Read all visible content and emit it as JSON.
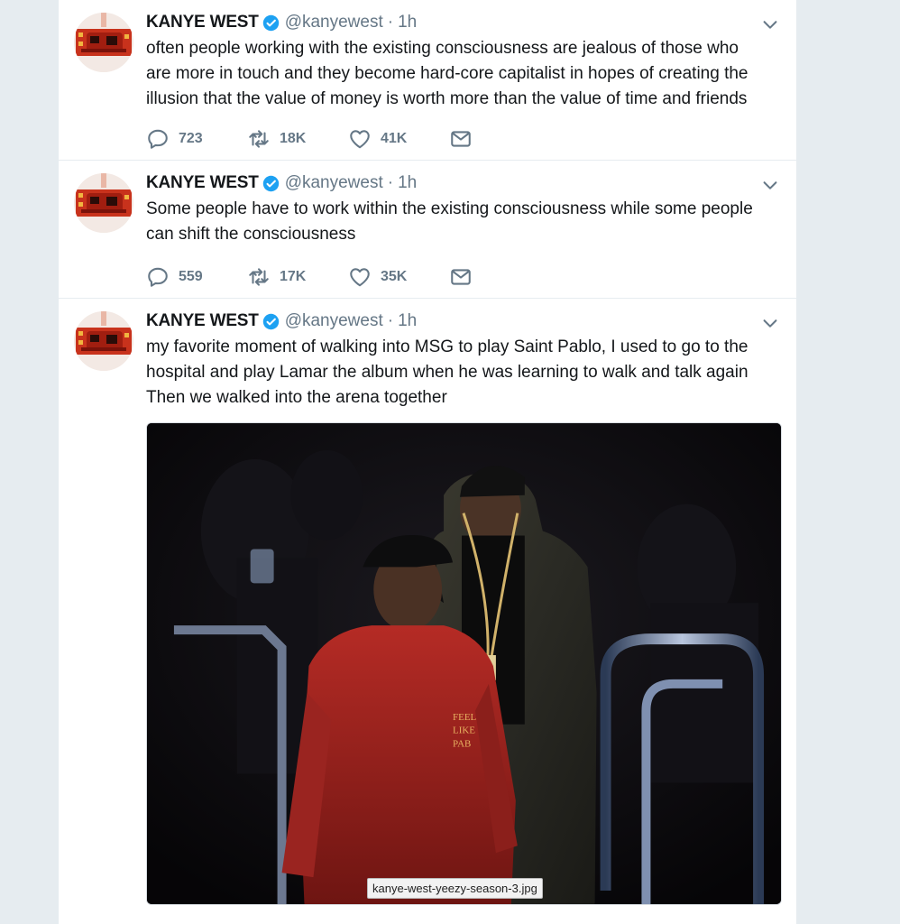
{
  "tweets": [
    {
      "name": "KANYE WEST",
      "handle": "@kanyewest",
      "separator": "·",
      "time": "1h",
      "text": "often people working with the existing consciousness are jealous of those who\nare more in touch and they become hard-core capitalist in hopes of creating the\nillusion that the value of money is worth more than the value of time and  friends",
      "replies": "723",
      "retweets": "18K",
      "likes": "41K"
    },
    {
      "name": "KANYE WEST",
      "handle": "@kanyewest",
      "separator": "·",
      "time": "1h",
      "text": "Some people have to work within the existing consciousness while some people\ncan shift the consciousness",
      "replies": "559",
      "retweets": "17K",
      "likes": "35K"
    },
    {
      "name": "KANYE WEST",
      "handle": "@kanyewest",
      "separator": "·",
      "time": "1h",
      "text": "my favorite moment of walking into MSG to play Saint Pablo, I used to go to the\nhospital and play Lamar the album when he was learning to walk and talk again\nThen we walked into the arena together",
      "media_caption": "kanye-west-yeezy-season-3.jpg"
    }
  ],
  "icons": {
    "verified": "verified-badge-icon",
    "caret": "chevron-down-icon",
    "reply": "reply-icon",
    "retweet": "retweet-icon",
    "like": "heart-icon",
    "message": "envelope-icon"
  },
  "colors": {
    "background": "#e6ecf0",
    "text": "#14171a",
    "secondary": "#657786",
    "verified": "#1da1f2"
  }
}
